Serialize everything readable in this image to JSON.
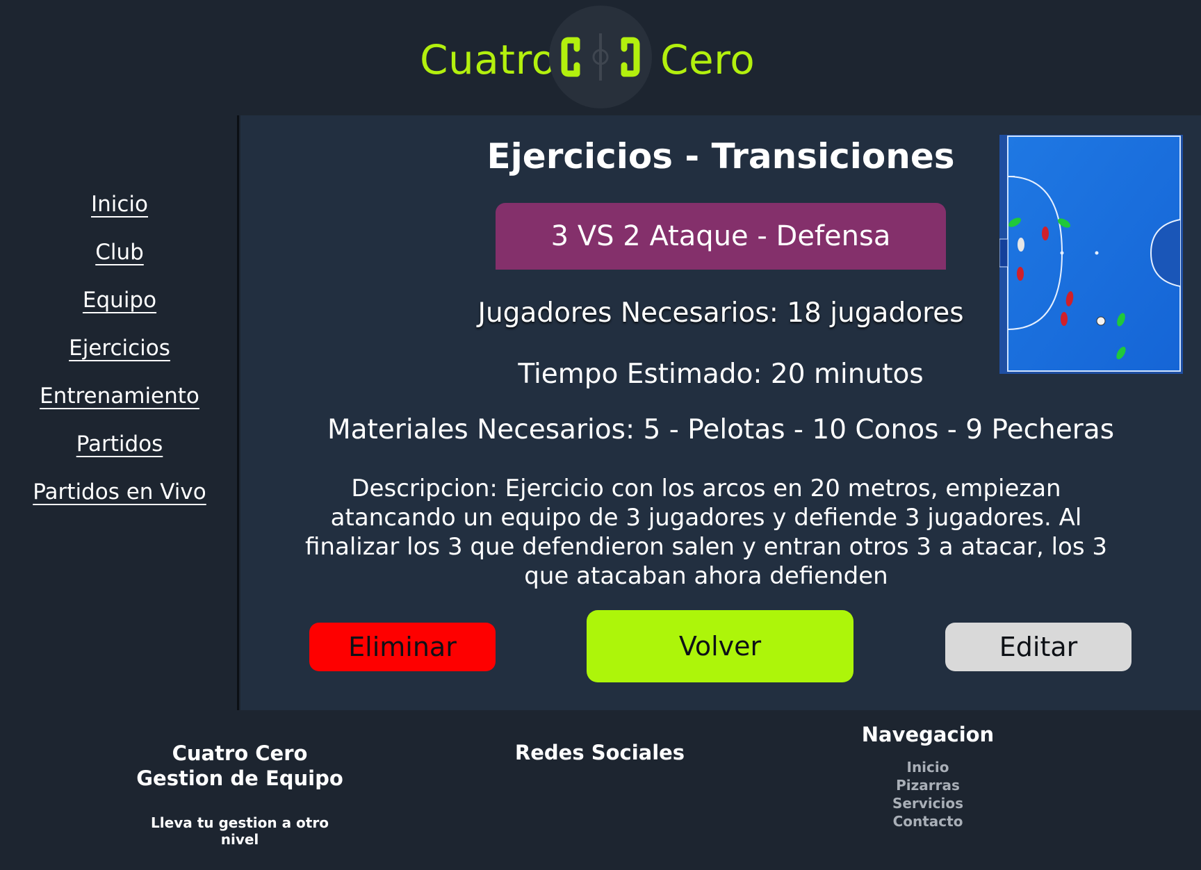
{
  "header": {
    "brand_left": "Cuatro",
    "brand_right": "Cero",
    "logo_icon": "futsal-court-logo-icon",
    "accent_color": "#b3f00e"
  },
  "sidebar": {
    "items": [
      {
        "label": "Inicio"
      },
      {
        "label": "Club"
      },
      {
        "label": "Equipo"
      },
      {
        "label": "Ejercicios"
      },
      {
        "label": "Entrenamiento"
      },
      {
        "label": "Partidos"
      },
      {
        "label": "Partidos en Vivo"
      }
    ]
  },
  "main": {
    "title": "Ejercicios - Transiciones",
    "exercise_name": "3 VS 2 Ataque - Defensa",
    "players": "Jugadores Necesarios: 18 jugadores",
    "time": "Tiempo Estimado: 20 minutos",
    "materials": "Materiales Necesarios: 5 - Pelotas - 10 Conos - 9 Pecheras",
    "description": "Descripcion: Ejercicio con los arcos en 20 metros, empiezan atancando un equipo de 3 jugadores y defiende 3 jugadores. Al finalizar los 3 que defendieron salen y entran otros 3 a atacar, los 3 que atacaban ahora defienden",
    "buttons": {
      "delete": "Eliminar",
      "back": "Volver",
      "edit": "Editar"
    },
    "button_colors": {
      "delete": "#fe0000",
      "back": "#adf50a",
      "edit": "#d9d9d9"
    },
    "banner_color": "#84306b",
    "board_image": "futsal-tactics-board-image"
  },
  "footer": {
    "brand_line1": "Cuatro Cero",
    "brand_line2": "Gestion de Equipo",
    "tagline": "Lleva tu gestion a otro nivel",
    "social_title": "Redes Sociales",
    "nav_title": "Navegacion",
    "nav_items": [
      {
        "label": "Inicio"
      },
      {
        "label": "Pizarras"
      },
      {
        "label": "Servicios"
      },
      {
        "label": "Contacto"
      }
    ]
  }
}
